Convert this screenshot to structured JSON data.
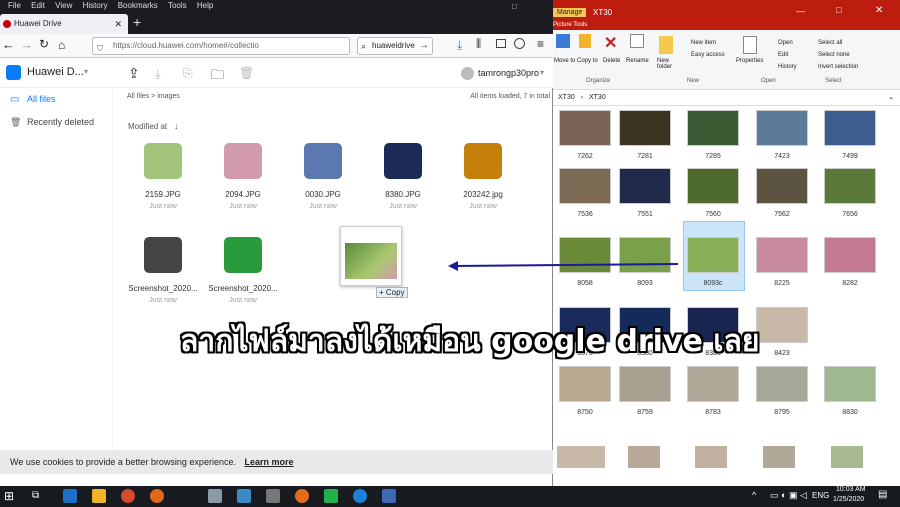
{
  "browser": {
    "menu": [
      "File",
      "Edit",
      "View",
      "History",
      "Bookmarks",
      "Tools",
      "Help"
    ],
    "tab_title": "Huawei Drive",
    "url": "https://cloud.huawei.com/home#/collectio",
    "search_value": "huaweidrive",
    "new_tab": "+",
    "close_tab": "✕"
  },
  "drive": {
    "app_title": "Huawei D...",
    "user": "tamrongp30pro",
    "sidebar": [
      {
        "label": "All files"
      },
      {
        "label": "Recently deleted"
      }
    ],
    "breadcrumb": {
      "root": "All files",
      "sep": ">",
      "current": "images"
    },
    "status": "All items loaded, 7 in total",
    "sort_label": "Modified at",
    "files": [
      {
        "name": "2159.JPG",
        "sub": "Just now",
        "color": "#a2c47a"
      },
      {
        "name": "2094.JPG",
        "sub": "Just now",
        "color": "#d39aaf"
      },
      {
        "name": "0030.JPG",
        "sub": "Just now",
        "color": "#5b78b0"
      },
      {
        "name": "8380.JPG",
        "sub": "Just now",
        "color": "#1c2a5a"
      },
      {
        "name": "203242.jpg",
        "sub": "Just now",
        "color": "#c4800a"
      },
      {
        "name": "Screenshot_2020...",
        "sub": "Just now",
        "color": "#444"
      },
      {
        "name": "Screenshot_2020...",
        "sub": "Just now",
        "color": "#2a9b3c"
      }
    ],
    "drag_copy_label": "+ Copy",
    "cookie_text": "We use cookies to provide a better browsing experience.",
    "cookie_link": "Learn more"
  },
  "explorer": {
    "title_tab": "Manage",
    "title_folder": "XT30",
    "ribbon_subtitle": "Picture Tools",
    "ribbon": {
      "organize": {
        "group": "Organize",
        "move": "Move to",
        "copy": "Copy to",
        "delete": "Delete",
        "rename": "Rename"
      },
      "new": {
        "group": "New",
        "folder": "New folder",
        "new_item": "New item",
        "easy_access": "Easy access"
      },
      "open": {
        "group": "Open",
        "properties": "Properties",
        "open": "Open",
        "edit": "Edit",
        "history": "History"
      },
      "select": {
        "group": "Select",
        "all": "Select all",
        "none": "Select none",
        "invert": "Invert selection"
      }
    },
    "path": [
      "XT30",
      "XT30"
    ],
    "items": [
      {
        "name": "7262",
        "color": "#7a6455"
      },
      {
        "name": "7281",
        "color": "#3b3422"
      },
      {
        "name": "7285",
        "color": "#3a5a33"
      },
      {
        "name": "7423",
        "color": "#5c7a9a"
      },
      {
        "name": "7499",
        "color": "#3d5c90"
      },
      {
        "name": "7536",
        "color": "#7d6a55"
      },
      {
        "name": "7551",
        "color": "#1f2a4a"
      },
      {
        "name": "7560",
        "color": "#4d6a2c"
      },
      {
        "name": "7562",
        "color": "#5c5340"
      },
      {
        "name": "7656",
        "color": "#5a7a3a"
      },
      {
        "name": "8058",
        "color": "#6a8a3a"
      },
      {
        "name": "8093",
        "color": "#7aa04a"
      },
      {
        "name": "8093c",
        "color": "#8ab05a"
      },
      {
        "name": "8225",
        "color": "#c88aa0"
      },
      {
        "name": "8282",
        "color": "#c47a90"
      },
      {
        "name": "8376",
        "color": "#1a2a5a"
      },
      {
        "name": "8380",
        "color": "#142a5a"
      },
      {
        "name": "8386",
        "color": "#1a2450"
      },
      {
        "name": "8423",
        "color": "#c8b8a8"
      },
      {
        "name": "",
        "color": "#ffffff"
      },
      {
        "name": "8750",
        "color": "#b8a890"
      },
      {
        "name": "8759",
        "color": "#a8a090"
      },
      {
        "name": "8783",
        "color": "#b0a898"
      },
      {
        "name": "8795",
        "color": "#a8a898"
      },
      {
        "name": "8830",
        "color": "#a0b890"
      }
    ]
  },
  "overlay_text": "ลากไฟล์มาลงได้เหมือน google drive เลย",
  "taskbar": {
    "lang": "ENG",
    "time": "10:03 AM",
    "date": "1/25/2020"
  }
}
